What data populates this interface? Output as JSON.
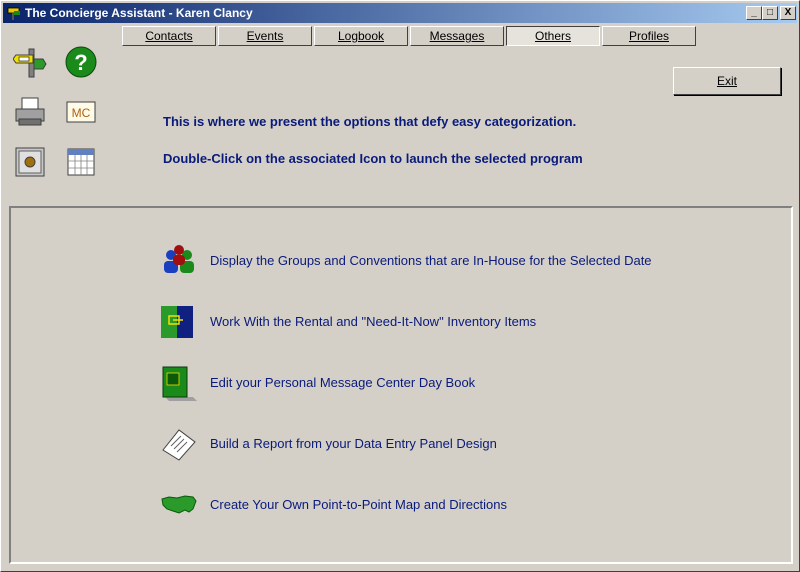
{
  "window": {
    "title": "The Concierge Assistant - Karen Clancy",
    "controls": {
      "minimize": "_",
      "maximize": "□",
      "close": "X"
    }
  },
  "tabs": [
    {
      "label": "Contacts",
      "active": false
    },
    {
      "label": "Events",
      "active": false
    },
    {
      "label": "Logbook",
      "active": false
    },
    {
      "label": "Messages",
      "active": false
    },
    {
      "label": "Others",
      "active": true
    },
    {
      "label": "Profiles",
      "active": false
    }
  ],
  "toolbar_icons": [
    {
      "name": "signpost-icon"
    },
    {
      "name": "help-icon"
    },
    {
      "name": "printer-icon"
    },
    {
      "name": "mc-icon",
      "text": "MC"
    },
    {
      "name": "safe-icon"
    },
    {
      "name": "calendar-icon"
    }
  ],
  "exit_label": "Exit",
  "info": {
    "line1": "This is where we present the options that defy easy categorization.",
    "line2": "Double-Click on the associated Icon to launch the selected program"
  },
  "options": [
    {
      "label": "Display the Groups and Conventions that are In-House for the Selected Date",
      "icon": "groups-icon"
    },
    {
      "label": "Work With the Rental and \"Need-It-Now\" Inventory Items",
      "icon": "inventory-icon"
    },
    {
      "label": "Edit your Personal Message Center Day Book",
      "icon": "daybook-icon"
    },
    {
      "label": "Build a Report from your Data Entry Panel Design",
      "icon": "report-icon"
    },
    {
      "label": "Create Your Own Point-to-Point Map and Directions",
      "icon": "map-icon"
    }
  ]
}
